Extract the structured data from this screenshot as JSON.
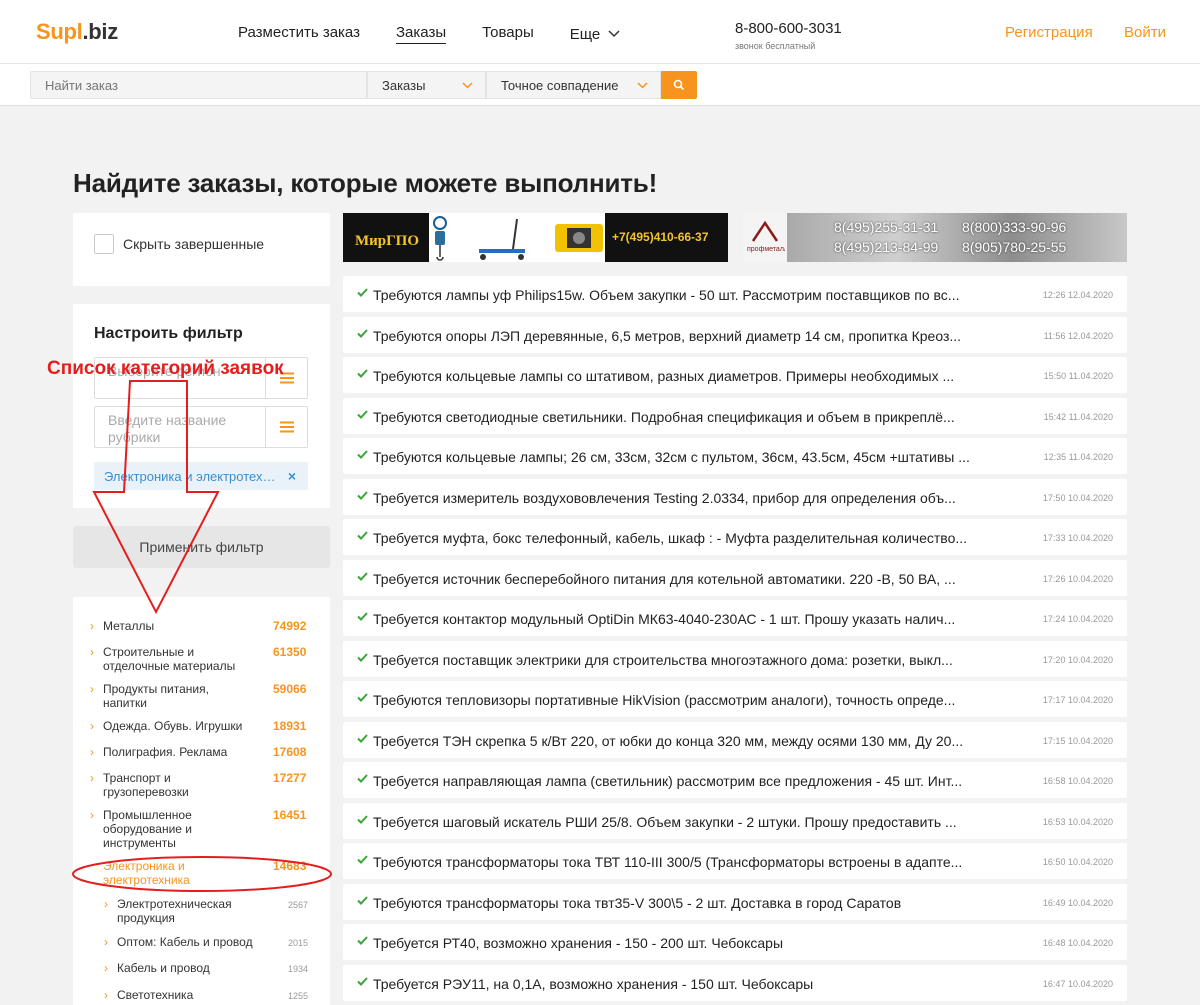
{
  "header": {
    "logo_part1": "Supl",
    "logo_part2": ".biz",
    "nav": [
      "Разместить заказ",
      "Заказы",
      "Товары",
      "Еще"
    ],
    "phone": "8-800-600-3031",
    "phone_note": "звонок бесплатный",
    "register": "Регистрация",
    "login": "Войти"
  },
  "search": {
    "placeholder": "Найти заказ",
    "scope": "Заказы",
    "match": "Точное совпадение"
  },
  "page_title": "Найдите заказы, которые можете выполнить!",
  "sidebar": {
    "hide_completed": "Скрыть завершенные",
    "filter_title": "Настроить фильтр",
    "region_placeholder": "Выберите регион",
    "rubric_placeholder": "Введите название рубрики",
    "selected_tag": "Электроника и электротехника",
    "apply_button": "Применить фильтр",
    "categories": [
      {
        "label": "Металлы",
        "count": "74992"
      },
      {
        "label": "Строительные и отделочные материалы",
        "count": "61350"
      },
      {
        "label": "Продукты питания, напитки",
        "count": "59066"
      },
      {
        "label": "Одежда. Обувь. Игрушки",
        "count": "18931"
      },
      {
        "label": "Полиграфия. Реклама",
        "count": "17608"
      },
      {
        "label": "Транспорт и грузоперевозки",
        "count": "17277"
      },
      {
        "label": "Промышленное оборудование и инструменты",
        "count": "16451"
      },
      {
        "label": "Электроника и электротехника",
        "count": "14683"
      }
    ],
    "subcategories": [
      {
        "label": "Электротехническая продукция",
        "count": "2567"
      },
      {
        "label": "Оптом: Кабель и провод",
        "count": "2015"
      },
      {
        "label": "Кабель и провод",
        "count": "1934"
      },
      {
        "label": "Светотехника",
        "count": "1255"
      }
    ]
  },
  "banners": {
    "b1_brand": "МирГПО",
    "b1_phone": "+7(495)410-66-37",
    "b2_brand": "профметалл",
    "b2_phones": [
      "8(495)255-31-31",
      "8(800)333-90-96",
      "8(495)213-84-99",
      "8(905)780-25-55"
    ]
  },
  "orders": [
    {
      "text": "Требуются лампы уф Philips15w. Объем закупки - 50 шт. Рассмотрим поставщиков по вс...",
      "time": "12:26 12.04.2020"
    },
    {
      "text": "Требуются опоры ЛЭП деревянные, 6,5 метров, верхний диаметр 14 см, пропитка Креоз...",
      "time": "11:56 12.04.2020"
    },
    {
      "text": "Требуются кольцевые лампы со штативом, разных диаметров. Примеры необходимых ...",
      "time": "15:50 11.04.2020"
    },
    {
      "text": "Требуются светодиодные светильники. Подробная спецификация и объем в прикреплё...",
      "time": "15:42 11.04.2020"
    },
    {
      "text": "Требуются кольцевые лампы; 26 см, 33см, 32см с пультом, 36см, 43.5см, 45см +штативы ...",
      "time": "12:35 11.04.2020"
    },
    {
      "text": "Требуется измеритель воздухововлечения Testing 2.0334, прибор для определения объ...",
      "time": "17:50 10.04.2020"
    },
    {
      "text": "Требуется муфта, бокс телефонный, кабель, шкаф : - Муфта разделительная количество...",
      "time": "17:33 10.04.2020"
    },
    {
      "text": "Требуется источник бесперебойного питания для котельной автоматики. 220 -В, 50 ВА, ...",
      "time": "17:26 10.04.2020"
    },
    {
      "text": "Требуется контактор модульный OptiDin МК63-4040-230АС - 1 шт. Прошу указать налич...",
      "time": "17:24 10.04.2020"
    },
    {
      "text": "Требуется поставщик электрики для строительства многоэтажного дома: розетки, выкл...",
      "time": "17:20 10.04.2020"
    },
    {
      "text": "Требуются тепловизоры портативные HikVision (рассмотрим аналоги), точность опреде...",
      "time": "17:17 10.04.2020"
    },
    {
      "text": "Требуется ТЭН скрепка 5 к/Вт 220, от юбки до конца 320 мм, между осями 130 мм, Ду 20...",
      "time": "17:15 10.04.2020"
    },
    {
      "text": "Требуется направляющая лампа (светильник) рассмотрим все предложения - 45 шт. Инт...",
      "time": "16:58 10.04.2020"
    },
    {
      "text": "Требуется шаговый искатель РШИ 25/8. Объем закупки - 2 штуки. Прошу предоставить ...",
      "time": "16:53 10.04.2020"
    },
    {
      "text": "Требуются трансформаторы тока ТВТ 110-III 300/5 (Трансформаторы встроены в адапте...",
      "time": "16:50 10.04.2020"
    },
    {
      "text": "Требуются трансформаторы тока твт35-V 300\\5 - 2 шт. Доставка в город Саратов",
      "time": "16:49 10.04.2020"
    },
    {
      "text": "Требуется РТ40, возможно хранения - 150 - 200 шт. Чебоксары",
      "time": "16:48 10.04.2020"
    },
    {
      "text": "Требуется РЭУ11, на 0,1А, возможно хранения - 150 шт. Чебоксары",
      "time": "16:47 10.04.2020"
    }
  ],
  "annotation": {
    "text": "Список категорий заявок",
    "color": "#e41e1e"
  },
  "colors": {
    "accent": "#f7941d",
    "link": "#3a8fd1",
    "check": "#3aa63a"
  }
}
